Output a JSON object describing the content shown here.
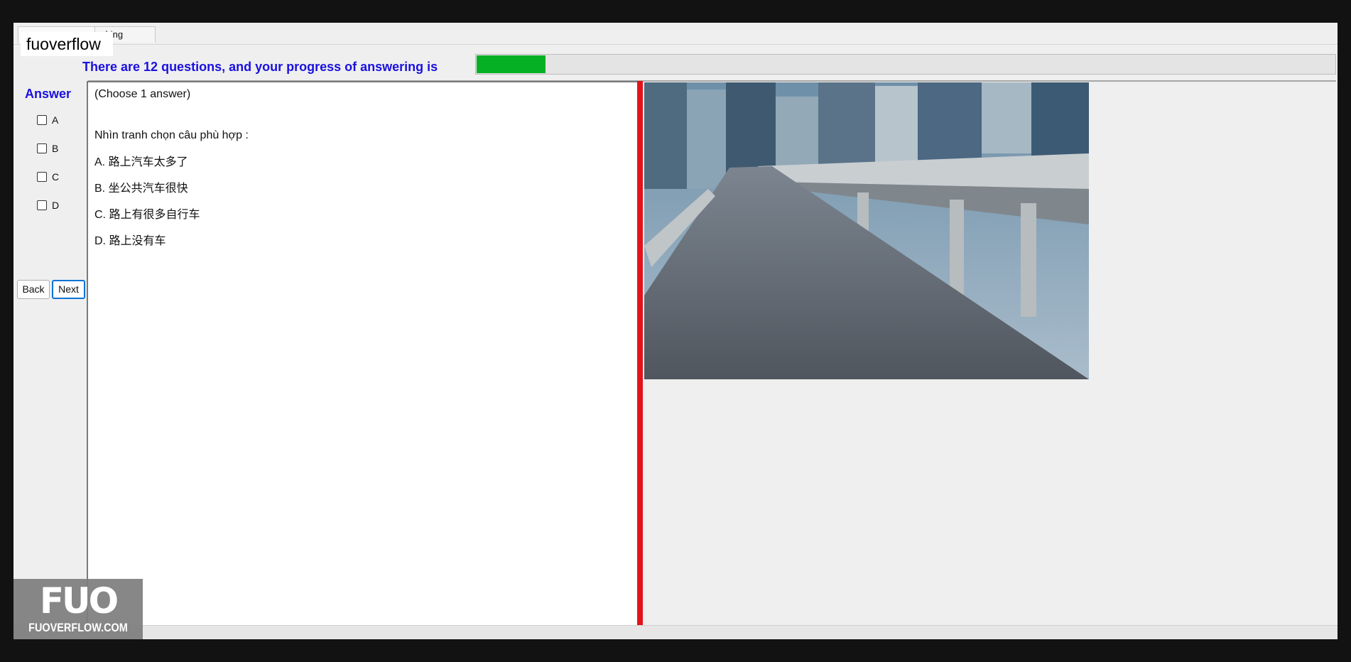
{
  "watermark": {
    "text": "fuoverflow"
  },
  "tabs": [
    {
      "label": ""
    },
    {
      "label": "ching"
    }
  ],
  "progress": {
    "text": "There are 12 questions, and your progress of answering is",
    "fraction": 0.08,
    "fill_color": "#06b025"
  },
  "answer_panel": {
    "title": "Answer",
    "options": [
      "A",
      "B",
      "C",
      "D"
    ],
    "back_label": "Back",
    "next_label": "Next"
  },
  "question": {
    "instruction": "(Choose 1 answer)",
    "prompt": "Nhìn tranh chọn câu phù hợp :",
    "choices": [
      {
        "letter": "A.",
        "text": "路上汽车太多了"
      },
      {
        "letter": "B.",
        "text": "坐公共汽车很快"
      },
      {
        "letter": "C.",
        "text": "路上有很多自行车"
      },
      {
        "letter": "D.",
        "text": "路上没有车"
      }
    ]
  },
  "image": {
    "subject": "traffic-jam-photo"
  },
  "logo": {
    "mark": "FUO",
    "url": "FUOVERFLOW.COM"
  },
  "colors": {
    "heading_blue": "#1a10e0",
    "splitter_red": "#e2131b",
    "progress_green": "#06b025"
  }
}
